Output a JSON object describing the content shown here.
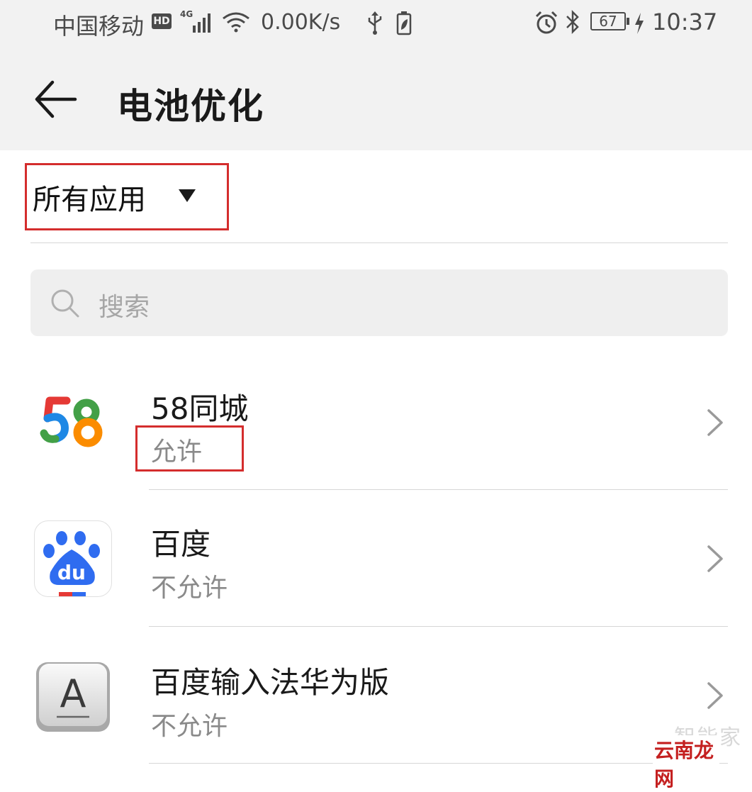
{
  "status_bar": {
    "carrier": "中国移动",
    "hd_badge": "HD",
    "network_type": "4G",
    "net_speed": "0.00K/s",
    "battery_level": "67",
    "time": "10:37",
    "icons": [
      "signal-icon",
      "wifi-icon",
      "usb-icon",
      "battery-saver-icon",
      "alarm-icon",
      "bluetooth-icon",
      "battery-icon",
      "charging-icon"
    ]
  },
  "header": {
    "title": "电池优化",
    "back_icon": "arrow-left-icon"
  },
  "filter": {
    "selected": "所有应用",
    "icon": "triangle-down-icon",
    "highlight_color": "#d42d2d"
  },
  "search": {
    "placeholder": "搜索",
    "icon": "search-icon"
  },
  "apps": [
    {
      "name": "58同城",
      "status": "允许",
      "icon": "app-58-icon"
    },
    {
      "name": "百度",
      "status": "不允许",
      "icon": "baidu-app-icon"
    },
    {
      "name": "百度输入法华为版",
      "status": "不允许",
      "icon": "baidu-input-app-icon"
    }
  ],
  "watermark": {
    "top": "智能家",
    "bottom": "云南龙网"
  },
  "colors": {
    "header_bg": "#f2f2f2",
    "highlight": "#d42d2d",
    "primary_text": "#1a1a1a",
    "secondary_text": "#8a8a8a"
  }
}
